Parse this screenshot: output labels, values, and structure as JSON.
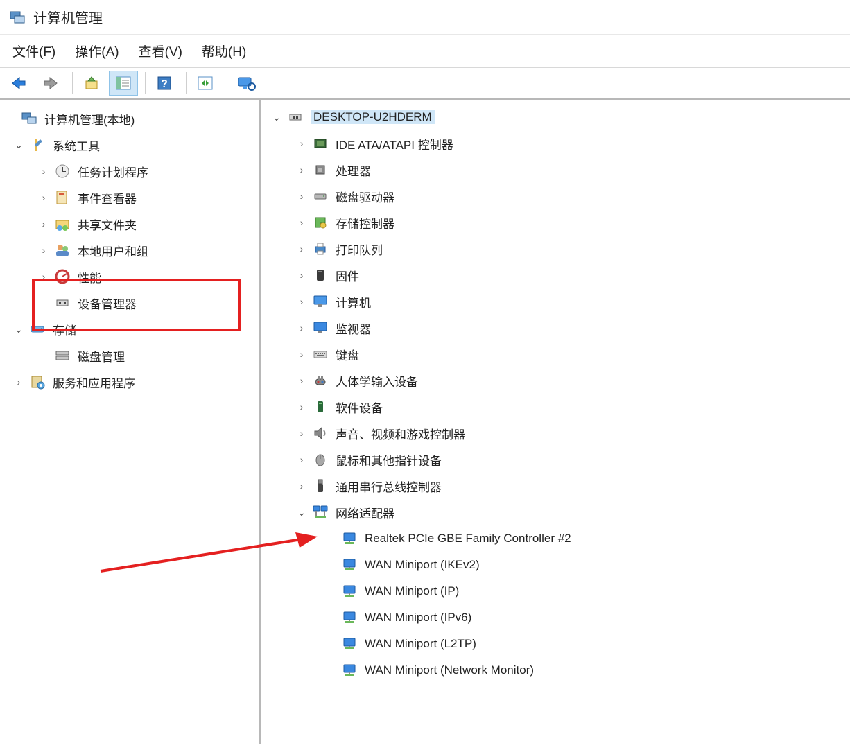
{
  "window": {
    "title": "计算机管理"
  },
  "menubar": {
    "file": "文件(F)",
    "action": "操作(A)",
    "view": "查看(V)",
    "help": "帮助(H)"
  },
  "left_tree": {
    "root": "计算机管理(本地)",
    "system_tools": "系统工具",
    "task_scheduler": "任务计划程序",
    "event_viewer": "事件查看器",
    "shared_folders": "共享文件夹",
    "local_users": "本地用户和组",
    "performance": "性能",
    "device_manager": "设备管理器",
    "storage": "存储",
    "disk_mgmt": "磁盘管理",
    "services_apps": "服务和应用程序"
  },
  "right_tree": {
    "computer": "DESKTOP-U2HDERM",
    "ide": "IDE ATA/ATAPI 控制器",
    "cpu": "处理器",
    "disk": "磁盘驱动器",
    "storage_ctrl": "存储控制器",
    "print": "打印队列",
    "firmware": "固件",
    "computers": "计算机",
    "monitors": "监视器",
    "keyboards": "键盘",
    "hid": "人体学输入设备",
    "software_dev": "软件设备",
    "sound": "声音、视频和游戏控制器",
    "mice": "鼠标和其他指针设备",
    "usb": "通用串行总线控制器",
    "net": "网络适配器",
    "net_items": [
      "Realtek PCIe GBE Family Controller #2",
      "WAN Miniport (IKEv2)",
      "WAN Miniport (IP)",
      "WAN Miniport (IPv6)",
      "WAN Miniport (L2TP)",
      "WAN Miniport (Network Monitor)"
    ]
  }
}
